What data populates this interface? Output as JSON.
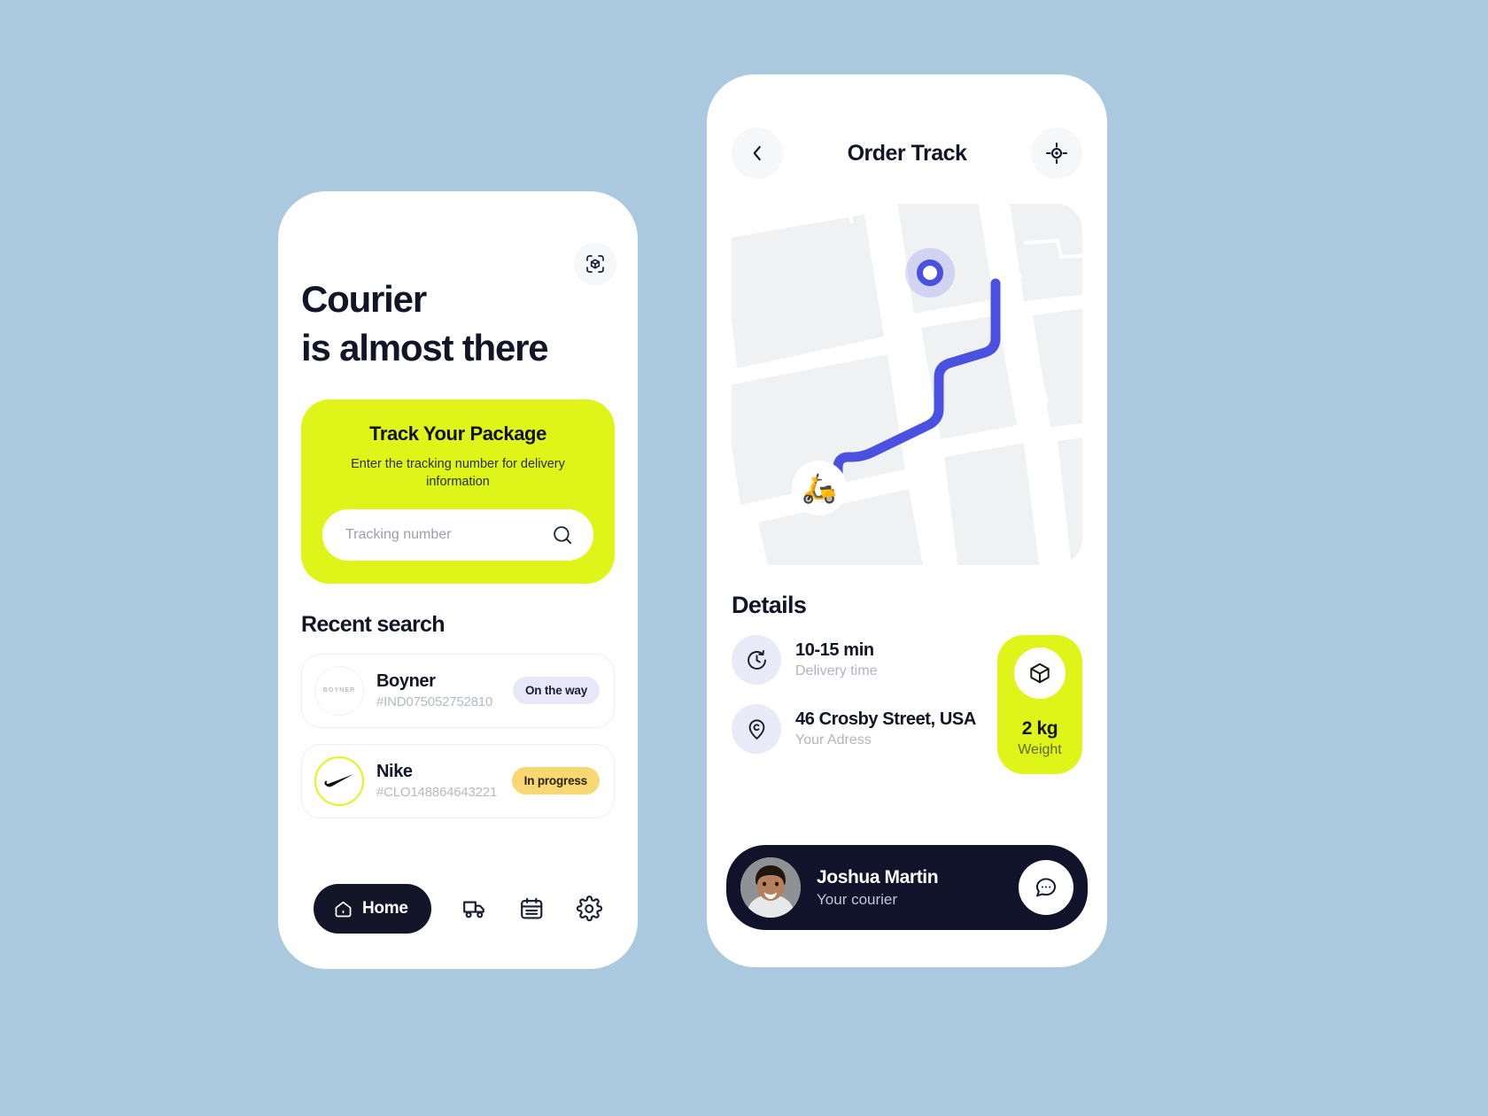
{
  "theme": {
    "background": "#aac9de",
    "accent_green": "#dff51a",
    "dark": "#101329",
    "route_blue": "#4a51e0",
    "badge_onway_bg": "#e7e7f7",
    "badge_inprogress_bg": "#f8d873"
  },
  "home_screen": {
    "scan_icon": "scan-package-icon",
    "headline_line1": "Courier",
    "headline_line2": "is almost there",
    "track_card": {
      "title": "Track Your Package",
      "subtitle": "Enter the tracking number for delivery information",
      "input_placeholder": "Tracking number",
      "input_value": "",
      "search_icon": "search-icon"
    },
    "recent_section_title": "Recent search",
    "recent_items": [
      {
        "logo_text": "BOYNER",
        "logo_name": "boyner-logo",
        "name": "Boyner",
        "code": "#IND075052752810",
        "status": "On the way",
        "status_style": "onway"
      },
      {
        "logo_text": "",
        "logo_name": "nike-logo",
        "name": "Nike",
        "code": "#CLO148864643221",
        "status": "In progress",
        "status_style": "inprog"
      }
    ],
    "navbar": {
      "home_label": "Home",
      "home_icon": "house-icon",
      "items": [
        {
          "icon": "truck-icon"
        },
        {
          "icon": "calendar-icon"
        },
        {
          "icon": "gear-icon"
        }
      ]
    }
  },
  "track_screen": {
    "back_icon": "chevron-left-icon",
    "title": "Order Track",
    "locate_icon": "crosshair-icon",
    "map": {
      "destination_marker": "destination-pin",
      "rider_marker": "scooter-icon",
      "rider_glyph": "🛵"
    },
    "details_title": "Details",
    "details": [
      {
        "icon": "clock-icon",
        "value": "10-15 min",
        "label": "Delivery time"
      },
      {
        "icon": "location-pin-icon",
        "value": "46 Crosby Street, USA",
        "label": "Your Adress"
      }
    ],
    "weight_card": {
      "icon": "box-icon",
      "value": "2 kg",
      "label": "Weight"
    },
    "courier": {
      "avatar": "courier-photo",
      "name": "Joshua Martin",
      "role": "Your courier",
      "chat_icon": "chat-bubble-icon"
    }
  }
}
